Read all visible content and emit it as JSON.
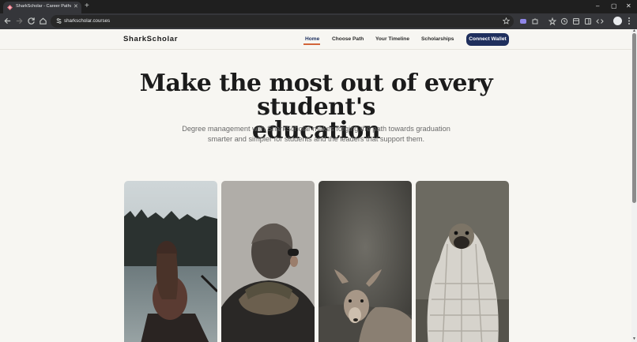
{
  "browser": {
    "tab_title": "SharkScholar - Career Pathways",
    "new_tab_label": "+",
    "url": "sharkscholar.courses",
    "window_controls": {
      "minimize": "–",
      "maximize": "▢",
      "close": "✕"
    }
  },
  "site": {
    "logo": "SharkScholar",
    "nav": [
      {
        "label": "Home",
        "active": true
      },
      {
        "label": "Choose Path",
        "active": false
      },
      {
        "label": "Your Timeline",
        "active": false
      },
      {
        "label": "Scholarships",
        "active": false
      }
    ],
    "cta_label": "Connect Wallet",
    "accent_color": "#d2653a",
    "brand_color": "#1f2f5d"
  },
  "hero": {
    "title_line1": "Make the most out of every student's",
    "title_line2": "education",
    "subtitle_line1": "Degree management with SharkScholar makes forging the path towards graduation",
    "subtitle_line2": "smarter and simpler for students and the leaders that support them."
  },
  "gallery": [
    {
      "subject": "woman-in-canoe-on-lake-photo"
    },
    {
      "subject": "person-with-scarf-and-glasses-photo"
    },
    {
      "subject": "young-deer-photo"
    },
    {
      "subject": "pug-wrapped-in-blanket-photo"
    }
  ]
}
